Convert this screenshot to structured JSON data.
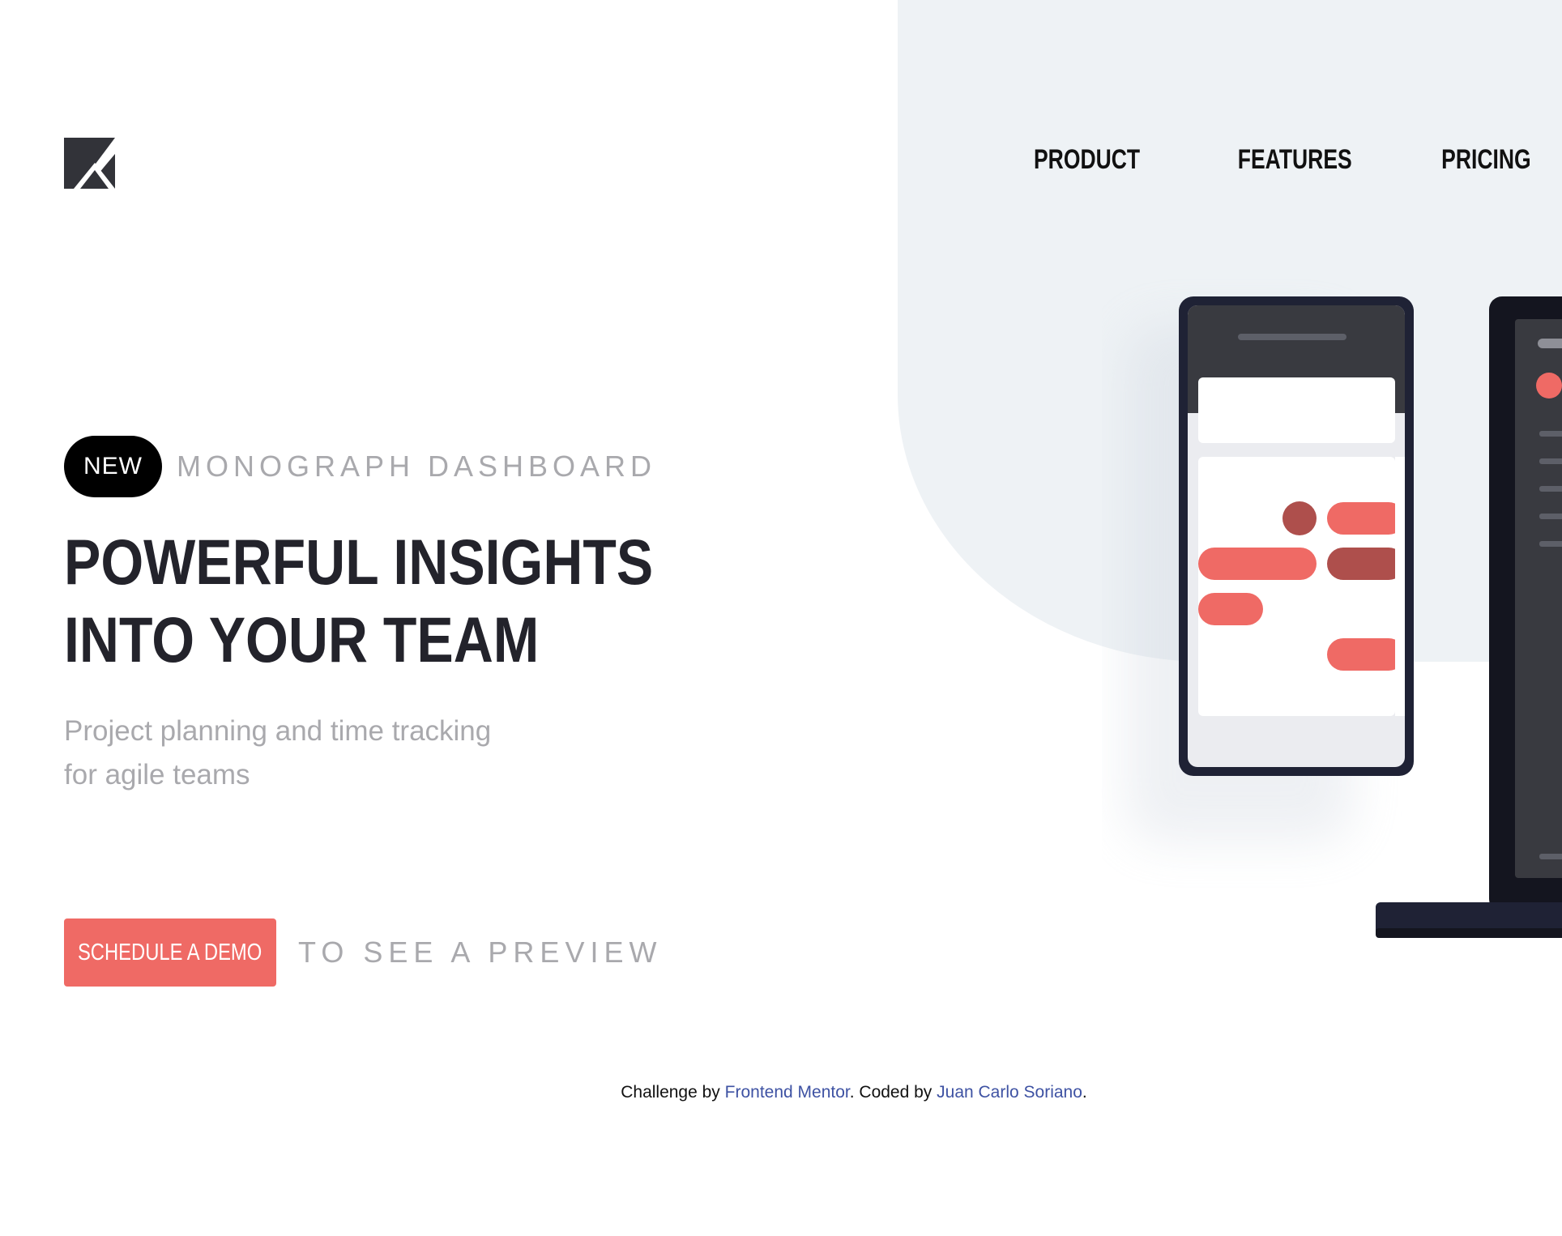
{
  "logo": {
    "icon": "monograph-logo-icon"
  },
  "nav": {
    "items": [
      {
        "label": "PRODUCT"
      },
      {
        "label": "FEATURES"
      },
      {
        "label": "PRICING"
      }
    ]
  },
  "hero": {
    "badge": "NEW",
    "tagline": "MONOGRAPH DASHBOARD",
    "headline_line1": "POWERFUL INSIGHTS",
    "headline_line2": "INTO YOUR TEAM",
    "subtext": "Project planning and time tracking for agile teams",
    "cta_label": "SCHEDULE A DEMO",
    "cta_suffix": "TO SEE A PREVIEW"
  },
  "footer": {
    "prefix": "Challenge by ",
    "challenge_link": "Frontend Mentor",
    "middle": ". Coded by ",
    "author_link": "Juan Carlo Soriano",
    "suffix": "."
  },
  "colors": {
    "accent": "#ef6a65",
    "accent_dark": "#ae4f4c",
    "hero_bg": "#eef2f5",
    "heading": "#23232b",
    "muted": "#a9a9ad",
    "link": "#3e52a3",
    "device_dark": "#1f2235"
  },
  "illustration": {
    "icon": "devices-illustration-icon"
  }
}
